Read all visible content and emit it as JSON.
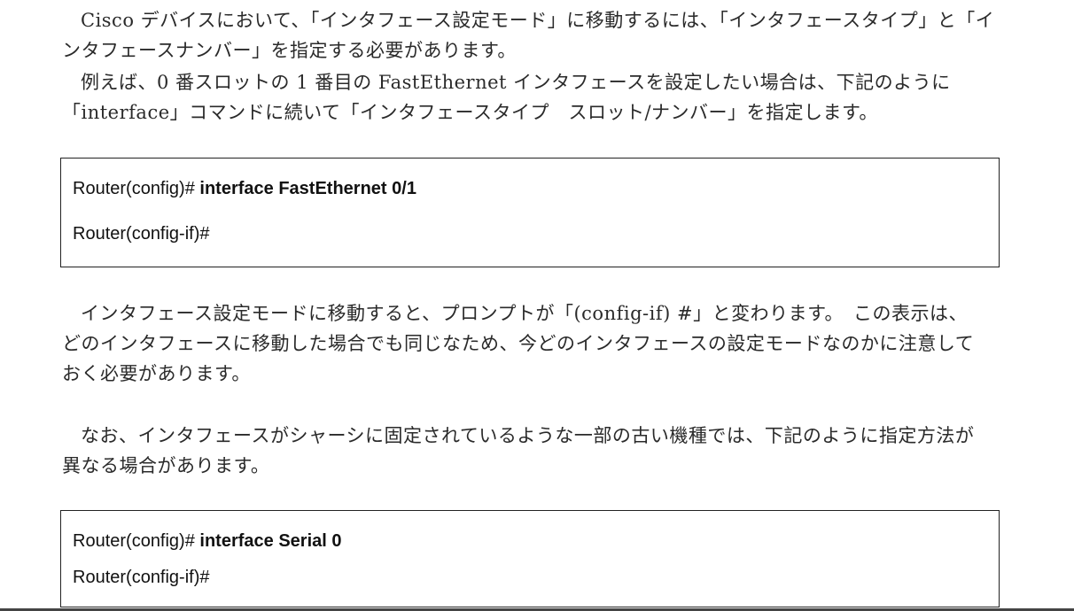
{
  "paragraph1": {
    "line1": "Cisco デバイスにおいて、「インタフェース設定モード」に移動するには、「インタフェースタイプ」と「イ",
    "line2": "ンタフェースナンバー」を指定する必要があります。"
  },
  "paragraph2": {
    "line1": "例えば、0 番スロットの 1 番目の FastEthernet インタフェースを設定したい場合は、下記のように",
    "line2": "「interface」コマンドに続いて「インタフェースタイプ　スロット/ナンバー」を指定します。"
  },
  "code_block1": {
    "line1_prompt": "Router(config)# ",
    "line1_command": "interface FastEthernet 0/1",
    "line2_prompt": "Router(config-if)#"
  },
  "paragraph3": {
    "line1": "インタフェース設定モードに移動すると、プロンプトが「(config-if) #」と変わります。　この表示は、",
    "line2": "どのインタフェースに移動した場合でも同じなため、今どのインタフェースの設定モードなのかに注意して",
    "line3": "おく必要があります。"
  },
  "paragraph4": {
    "line1": "なお、インタフェースがシャーシに固定されているような一部の古い機種では、下記のように指定方法が",
    "line2": "異なる場合があります。"
  },
  "code_block2": {
    "line1_prompt": "Router(config)# ",
    "line1_command": "interface Serial 0",
    "line2_prompt": "Router(config-if)#"
  }
}
